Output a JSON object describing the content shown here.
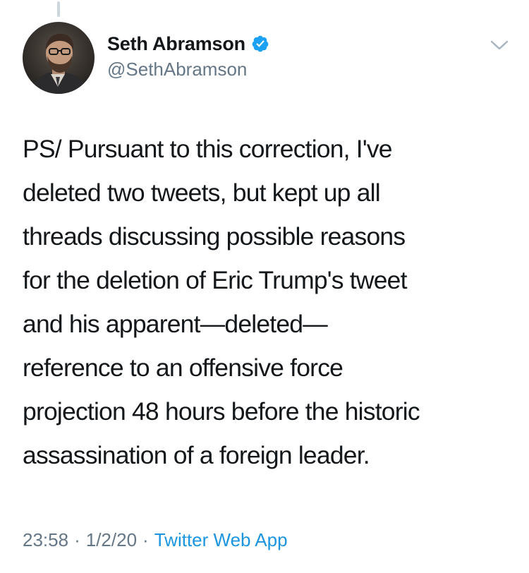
{
  "author": {
    "display_name": "Seth Abramson",
    "handle": "@SethAbramson",
    "verified": true,
    "verified_color": "#1da1f2"
  },
  "tweet": {
    "text": "PS/ Pursuant to this correction, I've\ndeleted two tweets, but kept up all\nthreads discussing possible reasons\nfor the deletion of Eric Trump's tweet\nand his apparent—deleted—\nreference to an offensive force\nprojection 48 hours before the historic\nassassination of a foreign leader."
  },
  "meta": {
    "time": "23:58",
    "separator": "·",
    "date": "1/2/20",
    "source": "Twitter Web App",
    "source_color": "#1b95e0"
  },
  "icons": {
    "verified": "verified-badge-icon",
    "menu": "chevron-down-icon"
  },
  "colors": {
    "text": "#14171a",
    "secondary": "#657786",
    "thread_line": "#ccd6dd"
  }
}
